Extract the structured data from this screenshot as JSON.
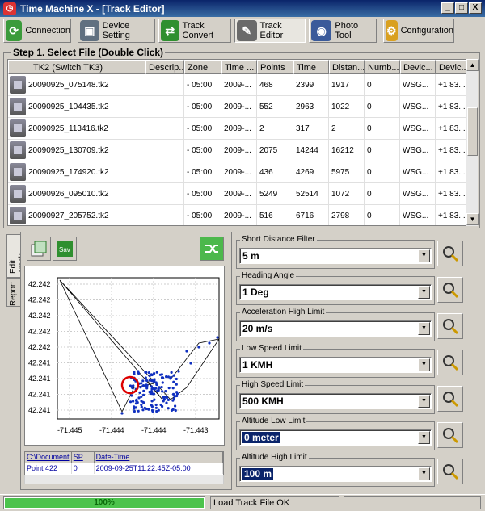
{
  "window": {
    "title": "Time Machine X - [Track Editor]",
    "min": "_",
    "max": "□",
    "close": "X"
  },
  "toolbar": [
    {
      "label": "Connection",
      "icon": "connection-icon",
      "color": "#3b9b3b"
    },
    {
      "label": "Device Setting",
      "icon": "device-setting-icon",
      "color": "#607080"
    },
    {
      "label": "Track Convert",
      "icon": "track-convert-icon",
      "color": "#2f8f2f"
    },
    {
      "label": "Track Editor",
      "icon": "track-editor-icon",
      "color": "#6a6a6a",
      "active": true
    },
    {
      "label": "Photo Tool",
      "icon": "photo-tool-icon",
      "color": "#3a5a9a"
    },
    {
      "label": "Configuration",
      "icon": "configuration-icon",
      "color": "#d9a020"
    }
  ],
  "step1": {
    "title": "Step 1. Select File (Double Click)"
  },
  "file_table": {
    "columns": [
      "TK2 (Switch TK3)",
      "Descrip...",
      "Zone",
      "Time ...",
      "Points",
      "Time",
      "Distan...",
      "Numb...",
      "Devic...",
      "Devic..."
    ],
    "rows": [
      [
        "20090925_075148.tk2",
        "",
        "- 05:00",
        "2009-...",
        "468",
        "2399",
        "1917",
        "0",
        "WSG...",
        "+1 83..."
      ],
      [
        "20090925_104435.tk2",
        "",
        "- 05:00",
        "2009-...",
        "552",
        "2963",
        "1022",
        "0",
        "WSG...",
        "+1 83..."
      ],
      [
        "20090925_113416.tk2",
        "",
        "- 05:00",
        "2009-...",
        "2",
        "317",
        "2",
        "0",
        "WSG...",
        "+1 83..."
      ],
      [
        "20090925_130709.tk2",
        "",
        "- 05:00",
        "2009-...",
        "2075",
        "14244",
        "16212",
        "0",
        "WSG...",
        "+1 83..."
      ],
      [
        "20090925_174920.tk2",
        "",
        "- 05:00",
        "2009-...",
        "436",
        "4269",
        "5975",
        "0",
        "WSG...",
        "+1 83..."
      ],
      [
        "20090926_095010.tk2",
        "",
        "- 05:00",
        "2009-...",
        "5249",
        "52514",
        "1072",
        "0",
        "WSG...",
        "+1 83..."
      ],
      [
        "20090927_205752.tk2",
        "",
        "- 05:00",
        "2009-...",
        "516",
        "6716",
        "2798",
        "0",
        "WSG...",
        "+1 83..."
      ]
    ]
  },
  "side_tabs": {
    "edit": "Edit Track",
    "report": "Report"
  },
  "plot": {
    "y_ticks": [
      "42.242",
      "42.242",
      "42.242",
      "42.242",
      "42.242",
      "42.241",
      "42.241",
      "42.241",
      "42.241"
    ],
    "x_ticks": [
      "-71.445",
      "-71.444",
      "-71.444",
      "-71.443"
    ]
  },
  "info_table": {
    "headers": [
      "C:\\Document",
      "SP",
      "Date-Time"
    ],
    "row": [
      "Point 422",
      "0",
      "2009-09-25T11:22:45Z-05:00"
    ]
  },
  "filters": [
    {
      "label": "Short Distance Filter",
      "value": "5 m",
      "highlight": false
    },
    {
      "label": "Heading Angle",
      "value": "1 Deg",
      "highlight": false
    },
    {
      "label": "Acceleration High Limit",
      "value": "20 m/s",
      "highlight": false
    },
    {
      "label": "Low Speed Limit",
      "value": "1 KMH",
      "highlight": false
    },
    {
      "label": "High Speed Limit",
      "value": "500 KMH",
      "highlight": false
    },
    {
      "label": "Altitude Low Limit",
      "value": "0 meter",
      "highlight": true
    },
    {
      "label": "Altitude High Limit",
      "value": "100 m",
      "highlight": true
    }
  ],
  "status": {
    "progress_pct": 100,
    "progress_text": "100%",
    "message": "Load Track File OK"
  }
}
